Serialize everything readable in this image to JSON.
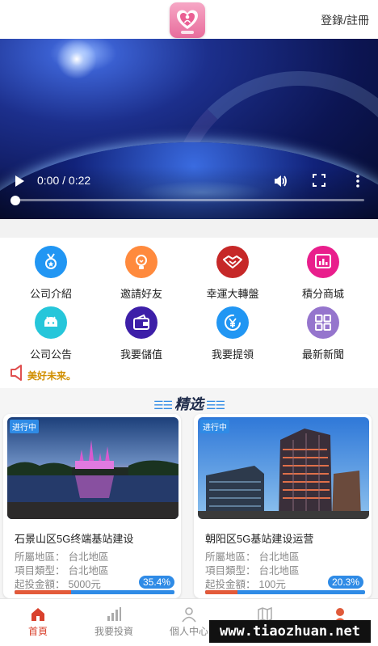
{
  "header": {
    "login_label": "登錄/註冊"
  },
  "video": {
    "time": "0:00 / 0:22",
    "progress": 0
  },
  "menu": [
    {
      "label": "公司介紹",
      "icon": "medal-icon",
      "color": "#2196f3"
    },
    {
      "label": "邀請好友",
      "icon": "bulb-icon",
      "color": "#ff8a3d"
    },
    {
      "label": "幸運大轉盤",
      "icon": "handshake-icon",
      "color": "#c62828"
    },
    {
      "label": "積分商城",
      "icon": "chart-icon",
      "color": "#e91e8c"
    },
    {
      "label": "公司公告",
      "icon": "android-icon",
      "color": "#26c6da"
    },
    {
      "label": "我要儲值",
      "icon": "wallet-icon",
      "color": "#3d1fa8"
    },
    {
      "label": "我要提領",
      "icon": "yen-icon",
      "color": "#2196f3"
    },
    {
      "label": "最新新聞",
      "icon": "grid-icon",
      "color": "#9575cd"
    }
  ],
  "notice": {
    "text": "美好未来。"
  },
  "featured": {
    "title": "精选"
  },
  "projects": [
    {
      "status": "进行中",
      "title": "石景山区5G终端基站建设",
      "region_label": "所屬地區：",
      "region": "台北地區",
      "type_label": "項目類型：",
      "type": "台北地區",
      "min_label": "起投金額：",
      "min": "5000元",
      "percent_text": "35.4%",
      "percent": 35.4
    },
    {
      "status": "进行中",
      "title": "朝阳区5G基站建设运营",
      "region_label": "所屬地區：",
      "region": "台北地區",
      "type_label": "項目類型：",
      "type": "台北地區",
      "min_label": "起投金額：",
      "min": "100元",
      "percent_text": "20.3%",
      "percent": 20.3
    }
  ],
  "nav": [
    {
      "label": "首頁",
      "icon": "home-icon"
    },
    {
      "label": "我要投資",
      "icon": "bar-chart-icon"
    },
    {
      "label": "個人中心",
      "icon": "user-icon"
    },
    {
      "label": "",
      "icon": "map-icon"
    },
    {
      "label": "",
      "icon": "service-icon"
    }
  ],
  "watermark": "www.tiaozhuan.net",
  "colors": {
    "accent": "#2f8be6",
    "active": "#d9412d",
    "progress": "#e35a3a"
  }
}
